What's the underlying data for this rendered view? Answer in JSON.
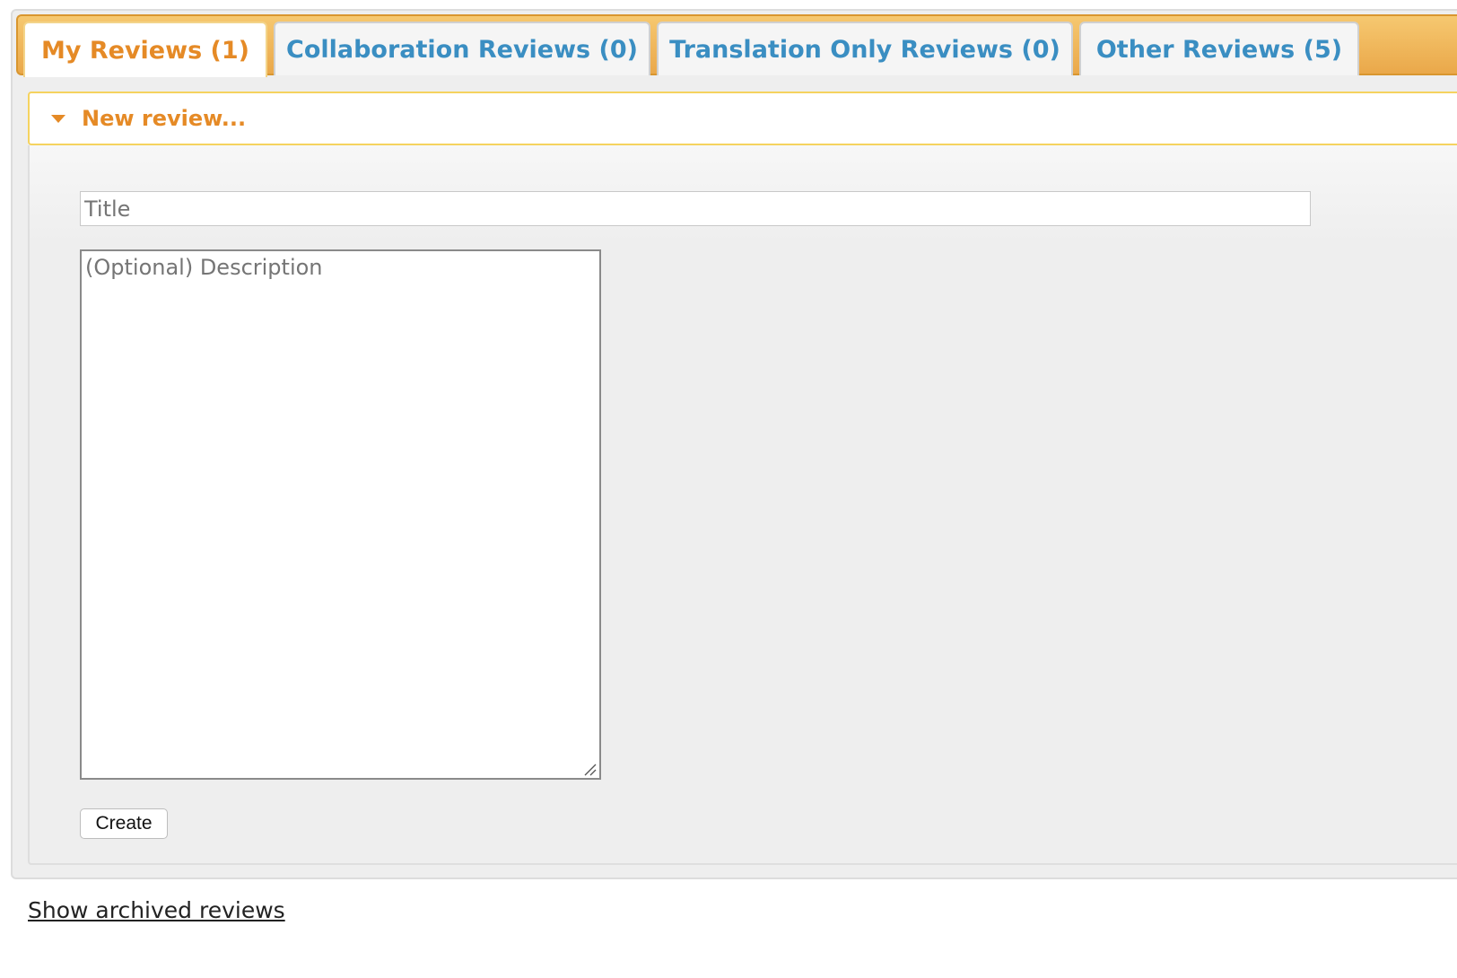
{
  "tabs": [
    {
      "label": "My Reviews (1)",
      "active": true
    },
    {
      "label": "Collaboration Reviews (0)",
      "active": false
    },
    {
      "label": "Translation Only Reviews (0)",
      "active": false
    },
    {
      "label": "Other Reviews (5)",
      "active": false
    }
  ],
  "new_review": {
    "header_label": "New review...",
    "header_icon": "triangle-down-icon",
    "expanded": true,
    "title_field": {
      "value": "",
      "placeholder": "Title"
    },
    "description_field": {
      "value": "",
      "placeholder": "(Optional) Description"
    },
    "create_label": "Create"
  },
  "archived_link_label": "Show archived reviews",
  "colors": {
    "tab_bar": "#eaa84a",
    "active_tab_text": "#e58a26",
    "inactive_tab_text": "#3a8ec2",
    "accordion_border": "#f5d35f"
  }
}
